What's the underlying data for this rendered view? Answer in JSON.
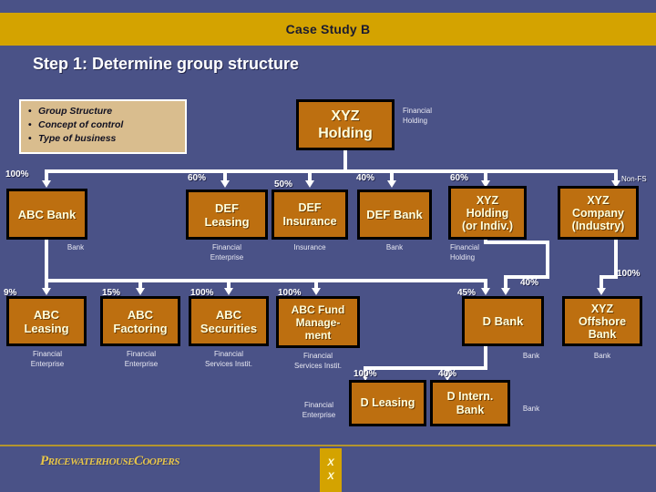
{
  "header": {
    "title": "Case Study B",
    "bar_color": "#d4a300"
  },
  "step_heading": "Step 1: Determine group structure",
  "bullets": {
    "marker": "•",
    "items": [
      "Group Structure",
      "Concept of control",
      "Type of business"
    ]
  },
  "theme": {
    "background": "#4a5287",
    "box_fill": "#bd6f10",
    "box_border": "#000000",
    "box_text": "#ffffdd",
    "line_color": "#ffffff",
    "accent_gold": "#d4a300",
    "card_fill": "#d9bd8e"
  },
  "chart_data": {
    "type": "diagram",
    "title": "Case Study B – Step 1: Determine group structure",
    "root": {
      "id": "xyz-holding",
      "label": "XYZ\nHolding",
      "caption": "Financial\nHolding"
    },
    "nodes": [
      {
        "id": "abc-bank",
        "label": "ABC Bank",
        "caption": "Bank",
        "pct": "100%",
        "parent": "xyz-holding",
        "row": 2
      },
      {
        "id": "def-leasing",
        "label": "DEF\nLeasing",
        "caption": "Financial\nEnterprise",
        "pct": "60%",
        "parent": "xyz-holding",
        "row": 2
      },
      {
        "id": "def-insurance",
        "label": "DEF\nInsurance",
        "caption": "Insurance",
        "pct": "50%",
        "parent": "xyz-holding",
        "row": 2
      },
      {
        "id": "def-bank",
        "label": "DEF Bank",
        "caption": "Bank",
        "pct": "40%",
        "parent": "xyz-holding",
        "row": 2
      },
      {
        "id": "xyz-holding-2",
        "label": "XYZ\nHolding\n(or Indiv.)",
        "caption": "Financial\nHolding",
        "pct": "60%",
        "parent": "xyz-holding",
        "row": 2
      },
      {
        "id": "xyz-company",
        "label": "XYZ\nCompany\n(Industry)",
        "caption": "",
        "pct": "Non-FS",
        "parent": "xyz-holding",
        "row": 2
      },
      {
        "id": "abc-leasing",
        "label": "ABC\nLeasing",
        "caption": "Financial\nEnterprise",
        "pct": "9%",
        "parent": "abc-bank",
        "row": 3
      },
      {
        "id": "abc-factoring",
        "label": "ABC\nFactoring",
        "caption": "Financial\nEnterprise",
        "pct": "15%",
        "parent": "abc-bank",
        "row": 3
      },
      {
        "id": "abc-securities",
        "label": "ABC\nSecurities",
        "caption": "Financial\nServices Instit.",
        "pct": "100%",
        "parent": "abc-bank",
        "row": 3
      },
      {
        "id": "abc-fund-mgmt",
        "label": "ABC Fund\nManage-\nment",
        "caption": "Financial\nServices Instit.",
        "pct": "100%",
        "parent": "abc-bank",
        "row": 3
      },
      {
        "id": "d-bank",
        "label": "D Bank",
        "caption": "Bank",
        "pct": "45%",
        "parent": "abc-bank",
        "row": 3,
        "pct2": "40%",
        "parent2": "xyz-holding-2"
      },
      {
        "id": "xyz-offshore",
        "label": "XYZ\nOffshore\nBank",
        "caption": "Bank",
        "pct": "100%",
        "parent": "xyz-company",
        "row": 3
      },
      {
        "id": "d-leasing",
        "label": "D Leasing",
        "caption": "Financial\nEnterprise",
        "pct": "100%",
        "parent": "d-bank",
        "row": 4
      },
      {
        "id": "d-intern-bank",
        "label": "D Intern.\nBank",
        "caption": "Bank",
        "pct": "40%",
        "parent": "d-bank",
        "row": 4
      }
    ],
    "labels": {
      "p100_a": "100%",
      "p60_a": "60%",
      "p50": "50%",
      "p40_a": "40%",
      "p60_b": "60%",
      "nonfs": "Non-FS",
      "p9": "9%",
      "p15": "15%",
      "p100_b": "100%",
      "p100_c": "100%",
      "p45": "45%",
      "p40_b": "40%",
      "p100_d": "100%",
      "p100_e": "100%",
      "p40_c": "40%"
    },
    "captions": {
      "c_bank1": "Bank",
      "c_fin_ent1": "Financial\nEnterprise",
      "c_insurance": "Insurance",
      "c_bank2": "Bank",
      "c_fin_hold2": "Financial\nHolding",
      "c_fin_ent2": "Financial\nEnterprise",
      "c_fin_ent3": "Financial\nEnterprise",
      "c_fsi1": "Financial\nServices Instit.",
      "c_fsi2": "Financial\nServices Instit.",
      "c_bank3": "Bank",
      "c_bank4": "Bank",
      "c_fin_ent4": "Financial\nEnterprise",
      "c_bank5": "Bank",
      "c_fin_hold1": "Financial\nHolding"
    }
  },
  "footer": {
    "logo_part1": "P",
    "logo_part2": "RICEWATERHOUSE",
    "logo_part3": "C",
    "logo_part4": "OOPERS",
    "badge_line1": "X",
    "badge_line2": "X"
  }
}
